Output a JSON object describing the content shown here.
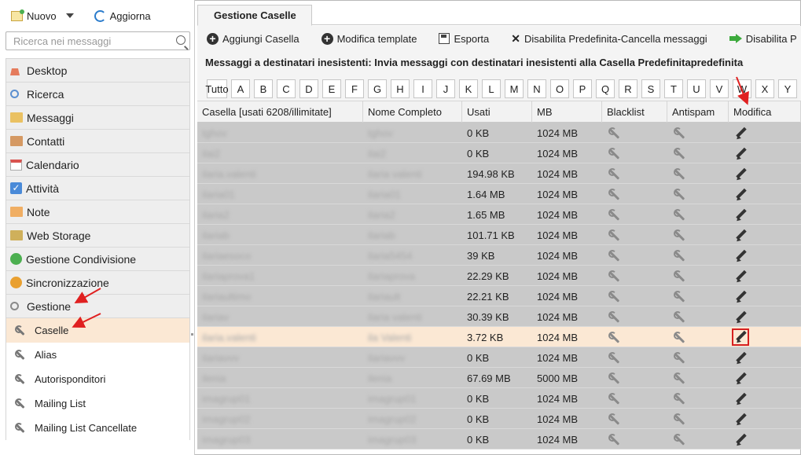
{
  "topbar": {
    "new_label": "Nuovo",
    "refresh_label": "Aggiorna"
  },
  "search": {
    "placeholder": "Ricerca nei messaggi"
  },
  "nav": {
    "items": [
      {
        "label": "Desktop",
        "icon": "home-icon",
        "color": "#e57b5c"
      },
      {
        "label": "Ricerca",
        "icon": "magnifier-icon",
        "color": "#5b8fd0"
      },
      {
        "label": "Messaggi",
        "icon": "envelope-icon",
        "color": "#e9b949"
      },
      {
        "label": "Contatti",
        "icon": "contacts-icon",
        "color": "#d08a4a"
      },
      {
        "label": "Calendario",
        "icon": "calendar-icon",
        "color": "#d9534f"
      },
      {
        "label": "Attività",
        "icon": "checkbox-icon",
        "color": "#4a8ad8"
      },
      {
        "label": "Note",
        "icon": "note-icon",
        "color": "#f0a24a"
      },
      {
        "label": "Web Storage",
        "icon": "folder-icon",
        "color": "#c9a441"
      },
      {
        "label": "Gestione Condivisione",
        "icon": "share-icon",
        "color": "#4caf50"
      },
      {
        "label": "Sincronizzazione",
        "icon": "sync-icon",
        "color": "#e9a030"
      },
      {
        "label": "Gestione",
        "icon": "tools-icon",
        "color": "#8a8a8a"
      }
    ],
    "subitems": [
      {
        "label": "Caselle",
        "active": true
      },
      {
        "label": "Alias"
      },
      {
        "label": "Autorisponditori"
      },
      {
        "label": "Mailing List"
      },
      {
        "label": "Mailing List Cancellate"
      }
    ]
  },
  "tab": {
    "label": "Gestione Caselle"
  },
  "toolbar": {
    "add_label": "Aggiungi Casella",
    "edit_template_label": "Modifica template",
    "export_label": "Esporta",
    "disable_default_label": "Disabilita Predefinita-Cancella messaggi",
    "disable_p_label": "Disabilita P"
  },
  "info": {
    "text": "Messaggi a destinatari inesistenti: Invia messaggi con destinatari inesistenti alla Casella Predefinitapredefinita"
  },
  "letters": [
    "Tutto",
    "A",
    "B",
    "C",
    "D",
    "E",
    "F",
    "G",
    "H",
    "I",
    "J",
    "K",
    "L",
    "M",
    "N",
    "O",
    "P",
    "Q",
    "R",
    "S",
    "T",
    "U",
    "V",
    "W",
    "X",
    "Y"
  ],
  "grid": {
    "columns": [
      "Casella [usati 6208/illimitate]",
      "Nome Completo",
      "Usati",
      "MB",
      "Blacklist",
      "Antispam",
      "Modifica"
    ],
    "rows": [
      {
        "casella": "tghov",
        "nome": "tghov",
        "usati": "0 KB",
        "mb": "1024 MB"
      },
      {
        "casella": "ilai2",
        "nome": "ilai2",
        "usati": "0 KB",
        "mb": "1024 MB"
      },
      {
        "casella": "ilaria.valenti",
        "nome": "ilaria valenti",
        "usati": "194.98 KB",
        "mb": "1024 MB"
      },
      {
        "casella": "ilaria01",
        "nome": "ilaria01",
        "usati": "1.64 MB",
        "mb": "1024 MB"
      },
      {
        "casella": "ilaria2",
        "nome": "ilaria2",
        "usati": "1.65 MB",
        "mb": "1024 MB"
      },
      {
        "casella": "ilariab",
        "nome": "ilariab",
        "usati": "101.71 KB",
        "mb": "1024 MB"
      },
      {
        "casella": "ilariaesoco",
        "nome": "ilaria5454",
        "usati": "39 KB",
        "mb": "1024 MB"
      },
      {
        "casella": "ilariaprova1",
        "nome": "ilariaprova",
        "usati": "22.29 KB",
        "mb": "1024 MB"
      },
      {
        "casella": "ilariaultimo",
        "nome": "ilariault",
        "usati": "22.21 KB",
        "mb": "1024 MB"
      },
      {
        "casella": "ilariav",
        "nome": "ilaria valenti",
        "usati": "30.39 KB",
        "mb": "1024 MB"
      },
      {
        "casella": "ilaria.valenti",
        "nome": "ila Valenti",
        "usati": "3.72 KB",
        "mb": "1024 MB",
        "selected": true
      },
      {
        "casella": "ilariavvv",
        "nome": "ilariavvv",
        "usati": "0 KB",
        "mb": "1024 MB"
      },
      {
        "casella": "ilenia",
        "nome": "ilenia",
        "usati": "67.69 MB",
        "mb": "5000 MB"
      },
      {
        "casella": "imagrup01",
        "nome": "imagrup01",
        "usati": "0 KB",
        "mb": "1024 MB"
      },
      {
        "casella": "imagrup02",
        "nome": "imagrup02",
        "usati": "0 KB",
        "mb": "1024 MB"
      },
      {
        "casella": "imagrup03",
        "nome": "imagrup03",
        "usati": "0 KB",
        "mb": "1024 MB"
      }
    ]
  },
  "colors": {
    "accent_red": "#d62020",
    "selected_row": "#fbe8d4",
    "row_bg": "#c9c9c9"
  }
}
